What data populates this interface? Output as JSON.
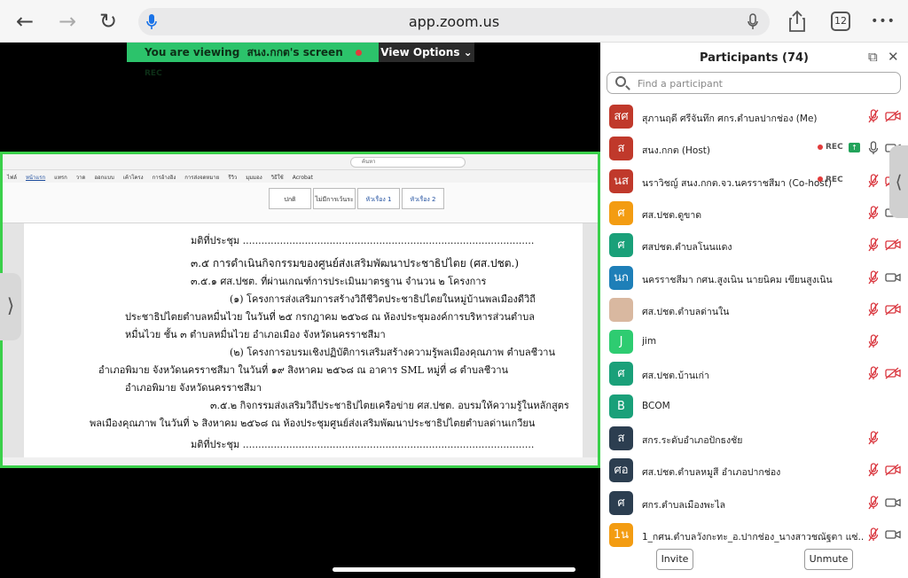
{
  "browser": {
    "url": "app.zoom.us",
    "tab_count": "12",
    "back_glyph": "←",
    "forward_glyph": "→",
    "reload_glyph": "↻",
    "more_glyph": "•••",
    "share_glyph": "⇪"
  },
  "share": {
    "viewing_prefix": "You are viewing",
    "sharer": "สนง.กกต's screen",
    "rec_label": "REC",
    "view_options_label": "View Options ⌄",
    "left_handle_glyph": "⟩"
  },
  "document": {
    "search_placeholder": "ค้นหา",
    "ribbon_tabs": [
      "ไฟล์",
      "หน้าแรก",
      "แทรก",
      "วาด",
      "ออกแบบ",
      "เค้าโครง",
      "การอ้างอิง",
      "การส่งจดหมาย",
      "รีวิว",
      "มุมมอง",
      "วิธีใช้",
      "Acrobat"
    ],
    "styles": [
      "ปกติ",
      "ไม่มีการเว้นระ",
      "หัวเรื่อง 1",
      "หัวเรื่อง 2"
    ],
    "lines": [
      "มติที่ประชุม ..............................................................................................",
      "๓.๕ การดำเนินกิจกรรมของศูนย์ส่งเสริมพัฒนาประชาธิปไตย (ศส.ปชต.)",
      "๓.๕.๑ ศส.ปชต. ที่ผ่านเกณฑ์การประเมินมาตรฐาน จำนวน ๒ โครงการ",
      "(๑) โครงการส่งเสริมการสร้างวิถีชีวิตประชาธิปไตยในหมู่บ้านพลเมืองดีวิถี",
      "ประชาธิปไตยตำบลหมื่นไวย ในวันที่ ๒๕ กรกฎาคม ๒๕๖๘ ณ ห้องประชุมองค์การบริหารส่วนตำบล",
      "หมื่นไวย ชั้น ๓ ตำบลหมื่นไวย อำเภอเมือง จังหวัดนครราชสีมา",
      "(๒) โครงการอบรมเชิงปฏิบัติการเสริมสร้างความรู้พลเมืองคุณภาพ ตำบลชีวาน",
      "อำเภอพิมาย จังหวัดนครราชสีมา ในวันที่ ๑๙ สิงหาคม ๒๕๖๘ ณ อาคาร SML หมู่ที่ ๘ ตำบลชีวาน",
      "อำเภอพิมาย จังหวัดนครราชสีมา",
      "๓.๕.๒ กิจกรรมส่งเสริมวิถีประชาธิปไตยเครือข่าย ศส.ปชต. อบรมให้ความรู้ในหลักสูตร",
      "พลเมืองคุณภาพ ในวันที่ ๖ สิงหาคม ๒๕๖๘ ณ ห้องประชุมศูนย์ส่งเสริมพัฒนาประชาธิปไตยตำบลด่านเกวียน",
      "มติที่ประชุม .............................................................................................."
    ]
  },
  "participants": {
    "title": "Participants (74)",
    "search_placeholder": "Find a participant",
    "popout_glyph": "⧉",
    "close_glyph": "✕",
    "right_handle_glyph": "⟨",
    "invite_label": "Invite",
    "unmute_label": "Unmute",
    "list": [
      {
        "initials": "สศ",
        "color": "#c0392b",
        "name": "สุภานฤดี ศรีจันทึก ศกร.ตำบลปากช่อง (Me)",
        "rec": "",
        "share": false,
        "mic": "muted",
        "cam": "off"
      },
      {
        "initials": "ส",
        "color": "#c0392b",
        "name": "สนง.กกต (Host)",
        "rec": "REC",
        "share": true,
        "mic": "on",
        "cam": "on"
      },
      {
        "initials": "นส",
        "color": "#c0392b",
        "name": "นราวิชญ์ สนง.กกต.จว.นครราชสีมา (Co-host)",
        "rec": "REC",
        "share": false,
        "mic": "muted",
        "cam": "off"
      },
      {
        "initials": "ศ",
        "color": "#f39c12",
        "name": "ศส.ปชต.ดูขาด",
        "rec": "",
        "share": false,
        "mic": "muted",
        "cam": "on"
      },
      {
        "initials": "ศ",
        "color": "#1aa079",
        "name": "ศสปชต.ตำบลโนนแดง",
        "rec": "",
        "share": false,
        "mic": "muted",
        "cam": "off"
      },
      {
        "initials": "นก",
        "color": "#1e7fb8",
        "name": "นครราชสีมา กศน.สูงเนิน นายนิคม เขียนสูงเนิน",
        "rec": "",
        "share": false,
        "mic": "muted",
        "cam": "on"
      },
      {
        "initials": "",
        "color": "#d9b8a0",
        "name": "ศส.ปชต.ตำบลด่านใน",
        "rec": "",
        "share": false,
        "mic": "muted",
        "cam": "off"
      },
      {
        "initials": "J",
        "color": "#2ecc71",
        "name": "jim",
        "rec": "",
        "share": false,
        "mic": "muted",
        "cam": "none"
      },
      {
        "initials": "ศ",
        "color": "#1aa079",
        "name": "ศส.ปชต.บ้านเก่า",
        "rec": "",
        "share": false,
        "mic": "muted",
        "cam": "off"
      },
      {
        "initials": "B",
        "color": "#1aa079",
        "name": "BCOM",
        "rec": "",
        "share": false,
        "mic": "none",
        "cam": "none"
      },
      {
        "initials": "ส",
        "color": "#2c3e50",
        "name": "สกร.ระดับอำเภอปักธงชัย",
        "rec": "",
        "share": false,
        "mic": "muted",
        "cam": "none"
      },
      {
        "initials": "ศอ",
        "color": "#2c3e50",
        "name": "ศส.ปชต.ตำบลหมูสี อำเภอปากช่อง",
        "rec": "",
        "share": false,
        "mic": "muted",
        "cam": "off"
      },
      {
        "initials": "ศ",
        "color": "#2c3e50",
        "name": "ศกร.ตำบลเมืองพะไล",
        "rec": "",
        "share": false,
        "mic": "muted",
        "cam": "on"
      },
      {
        "initials": "1น",
        "color": "#f39c12",
        "name": "1_กศน.ตำบลวังกะทะ_อ.ปากช่อง_นางสาวชณัฐตา แซ่...",
        "rec": "",
        "share": false,
        "mic": "muted",
        "cam": "on"
      }
    ]
  }
}
